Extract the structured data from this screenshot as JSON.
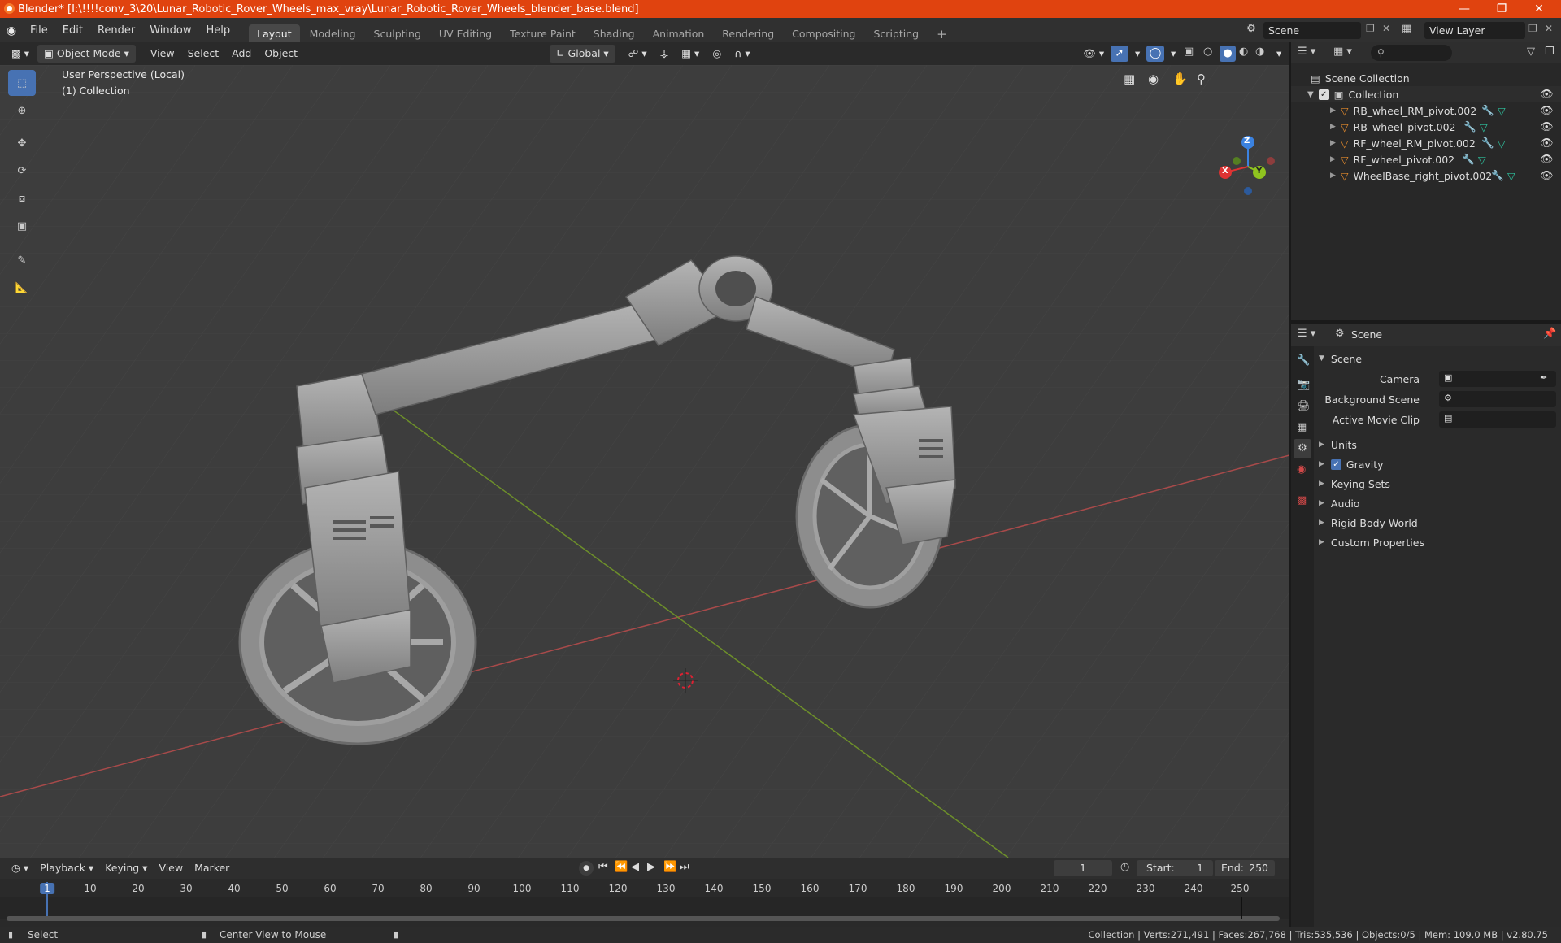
{
  "titlebar": {
    "title": "Blender* [I:\\!!!!conv_3\\20\\Lunar_Robotic_Rover_Wheels_max_vray\\Lunar_Robotic_Rover_Wheels_blender_base.blend]",
    "color": "#e0430f"
  },
  "menu": {
    "items": [
      "File",
      "Edit",
      "Render",
      "Window",
      "Help"
    ],
    "workspaces": [
      "Layout",
      "Modeling",
      "Sculpting",
      "UV Editing",
      "Texture Paint",
      "Shading",
      "Animation",
      "Rendering",
      "Compositing",
      "Scripting"
    ],
    "active_workspace": "Layout",
    "add_tab": "+",
    "scene_name": "Scene",
    "view_layer": "View Layer"
  },
  "viewport_header": {
    "mode": "Object Mode",
    "menus": [
      "View",
      "Select",
      "Add",
      "Object"
    ],
    "transform_orientation": "Global"
  },
  "viewport": {
    "overlay_line1": "User Perspective (Local)",
    "overlay_line2": "(1) Collection",
    "gizmo_axes": [
      "X",
      "Y",
      "Z"
    ],
    "tools": [
      "select-box-icon",
      "cursor-icon",
      "move-icon",
      "rotate-icon",
      "scale-icon",
      "transform-icon",
      "annotate-icon",
      "measure-icon"
    ],
    "nav_icons": [
      "grid-icon",
      "camera-icon",
      "hand-icon",
      "zoom-icon"
    ],
    "object_color": "#9a9a9a"
  },
  "outliner": {
    "root": "Scene Collection",
    "collection": "Collection",
    "objects": [
      {
        "name": "RB_wheel_RM_pivot.002"
      },
      {
        "name": "RB_wheel_pivot.002"
      },
      {
        "name": "RF_wheel_RM_pivot.002"
      },
      {
        "name": "RF_wheel_pivot.002"
      },
      {
        "name": "WheelBase_right_pivot.002"
      }
    ]
  },
  "properties": {
    "context": "Scene",
    "panel_title": "Scene",
    "fields": [
      {
        "label": "Camera"
      },
      {
        "label": "Background Scene"
      },
      {
        "label": "Active Movie Clip"
      }
    ],
    "sections": [
      "Units",
      "Gravity",
      "Keying Sets",
      "Audio",
      "Rigid Body World",
      "Custom Properties"
    ],
    "gravity_checked": true
  },
  "timeline": {
    "menus": [
      "Playback",
      "Keying",
      "View",
      "Marker"
    ],
    "current_frame": "1",
    "start_label": "Start:",
    "start_value": "1",
    "end_label": "End:",
    "end_value": "250",
    "ruler": [
      "1",
      "10",
      "20",
      "30",
      "40",
      "50",
      "60",
      "70",
      "80",
      "90",
      "100",
      "110",
      "120",
      "130",
      "140",
      "150",
      "160",
      "170",
      "180",
      "190",
      "200",
      "210",
      "220",
      "230",
      "240",
      "250"
    ]
  },
  "statusbar": {
    "left_action": "Select",
    "middle_action": "Center View to Mouse",
    "stats": "Collection | Verts:271,491 | Faces:267,768 | Tris:535,536 | Objects:0/5 | Mem: 109.0 MB | v2.80.75"
  }
}
